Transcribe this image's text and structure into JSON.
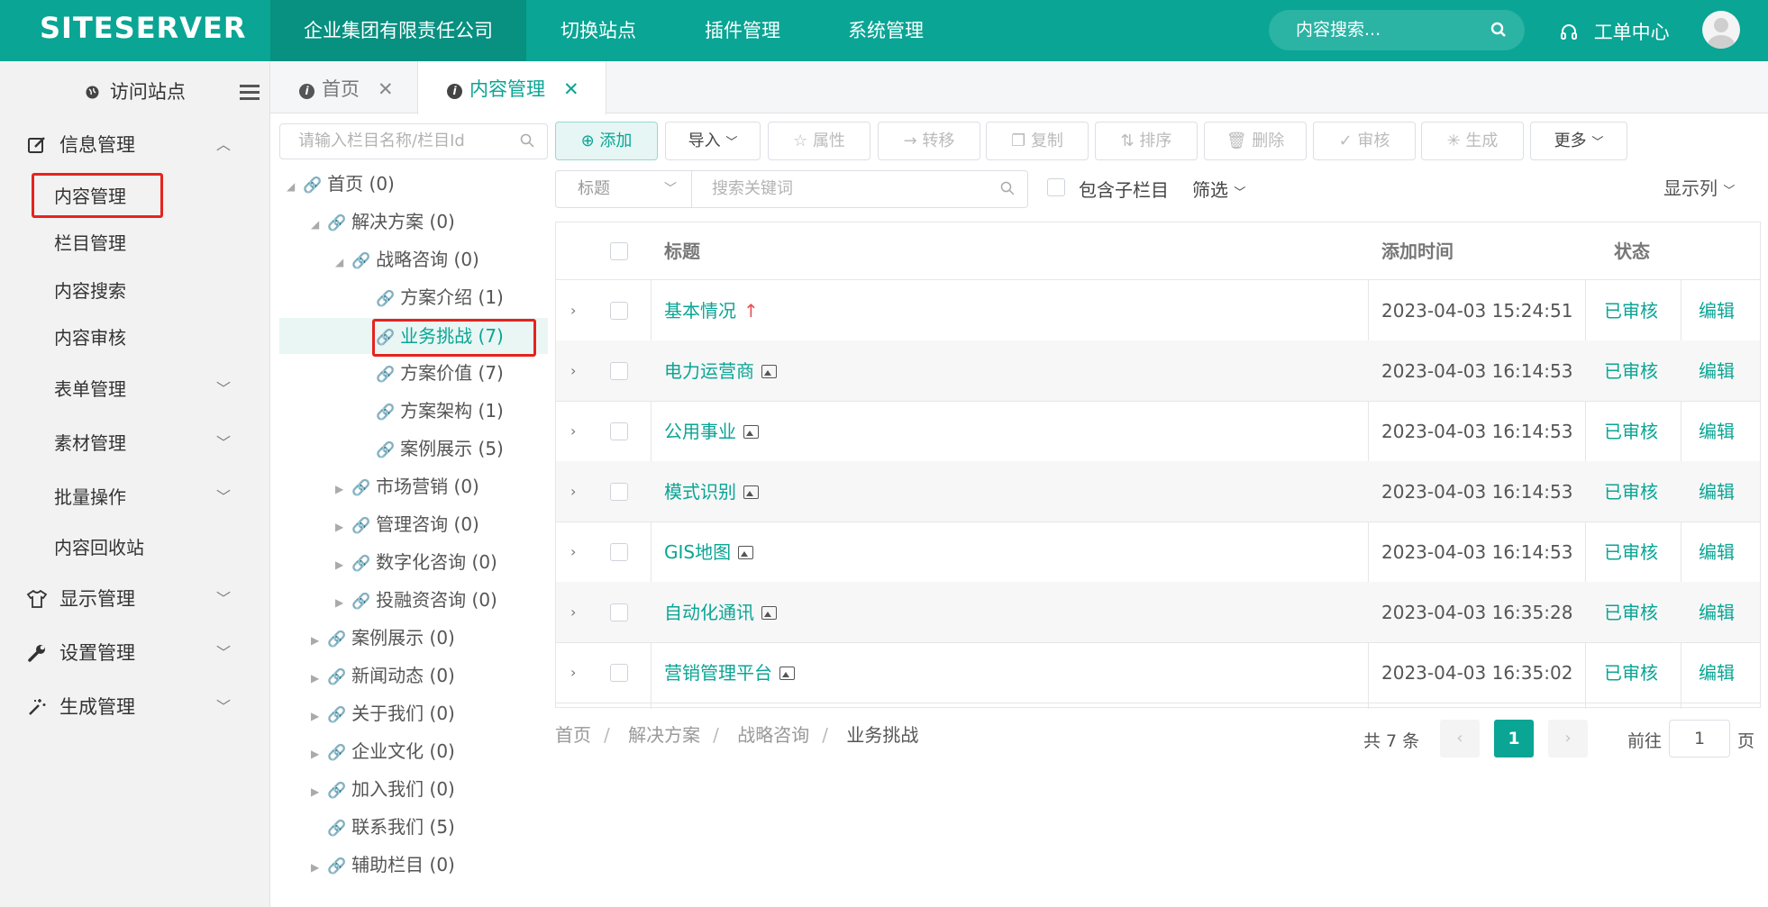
{
  "brand": {
    "logo": "SITESERVER",
    "accent": "#0aa594"
  },
  "topnav": {
    "items": [
      "企业集团有限责任公司",
      "切换站点",
      "插件管理",
      "系统管理"
    ],
    "search_placeholder": "内容搜索...",
    "workorder": "工单中心"
  },
  "sidebar": {
    "visit": "访问站点",
    "groups": [
      {
        "label": "信息管理",
        "icon": "edit-icon"
      },
      {
        "label": "显示管理",
        "icon": "shirt-icon"
      },
      {
        "label": "设置管理",
        "icon": "wrench-icon"
      },
      {
        "label": "生成管理",
        "icon": "magic-wand-icon"
      }
    ],
    "sub": [
      "内容管理",
      "栏目管理",
      "内容搜索",
      "内容审核",
      "表单管理",
      "素材管理",
      "批量操作",
      "内容回收站"
    ]
  },
  "tabs": [
    {
      "label": "首页"
    },
    {
      "label": "内容管理"
    }
  ],
  "tree": {
    "search_placeholder": "请输入栏目名称/栏目Id",
    "nodes": [
      "首页 (0)",
      "解决方案 (0)",
      "战略咨询 (0)",
      "方案介绍 (1)",
      "业务挑战 (7)",
      "方案价值 (7)",
      "方案架构 (1)",
      "案例展示 (5)",
      "市场营销 (0)",
      "管理咨询 (0)",
      "数字化咨询 (0)",
      "投融资咨询 (0)",
      "案例展示 (0)",
      "新闻动态 (0)",
      "关于我们 (0)",
      "企业文化 (0)",
      "加入我们 (0)",
      "联系我们 (5)",
      "辅助栏目 (0)"
    ]
  },
  "toolbar": {
    "add": "添加",
    "import": "导入",
    "attr": "属性",
    "move": "转移",
    "copy": "复制",
    "sort": "排序",
    "delete": "删除",
    "audit": "审核",
    "generate": "生成",
    "more": "更多"
  },
  "filter": {
    "field": "标题",
    "keyword_placeholder": "搜索关键词",
    "include_children": "包含子栏目",
    "screen": "筛选",
    "columns": "显示列"
  },
  "table": {
    "headers": {
      "title": "标题",
      "time": "添加时间",
      "status": "状态"
    },
    "rows": [
      {
        "title": "基本情况",
        "time": "2023-04-03 15:24:51",
        "status": "已审核",
        "action": "编辑",
        "mark": "up"
      },
      {
        "title": "电力运营商",
        "time": "2023-04-03 16:14:53",
        "status": "已审核",
        "action": "编辑",
        "mark": "image"
      },
      {
        "title": "公用事业",
        "time": "2023-04-03 16:14:53",
        "status": "已审核",
        "action": "编辑",
        "mark": "image"
      },
      {
        "title": "模式识别",
        "time": "2023-04-03 16:14:53",
        "status": "已审核",
        "action": "编辑",
        "mark": "image"
      },
      {
        "title": "GIS地图",
        "time": "2023-04-03 16:14:53",
        "status": "已审核",
        "action": "编辑",
        "mark": "image"
      },
      {
        "title": "自动化通讯",
        "time": "2023-04-03 16:35:28",
        "status": "已审核",
        "action": "编辑",
        "mark": "image"
      },
      {
        "title": "营销管理平台",
        "time": "2023-04-03 16:35:02",
        "status": "已审核",
        "action": "编辑",
        "mark": "image"
      }
    ]
  },
  "breadcrumb": [
    "首页",
    "解决方案",
    "战略咨询",
    "业务挑战"
  ],
  "pagination": {
    "total": "共 7 条",
    "current": "1",
    "goto": "前往",
    "goto_value": "1",
    "page_unit": "页"
  }
}
